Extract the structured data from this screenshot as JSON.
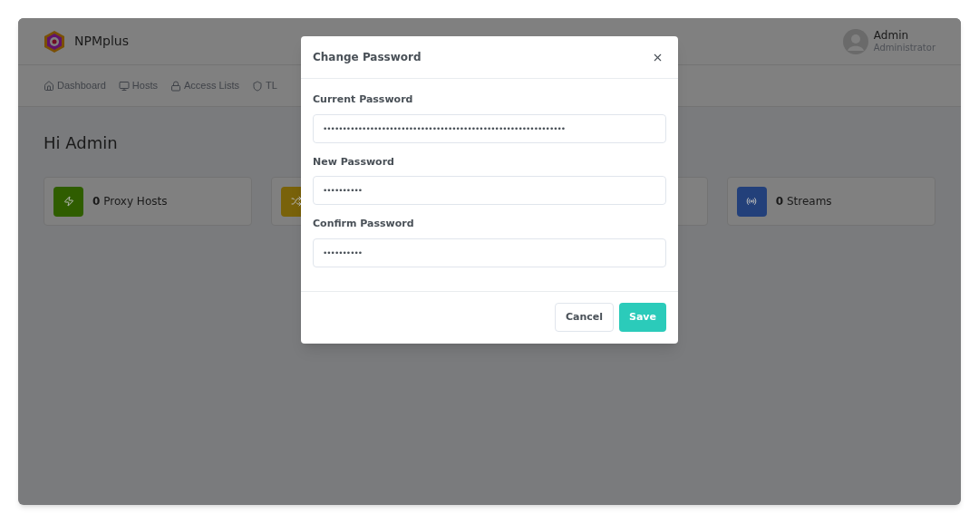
{
  "brand": {
    "name": "NPMplus"
  },
  "user": {
    "name": "Admin",
    "role": "Administrator"
  },
  "nav": [
    {
      "label": "Dashboard"
    },
    {
      "label": "Hosts"
    },
    {
      "label": "Access Lists"
    },
    {
      "label": "TL"
    }
  ],
  "greeting": "Hi Admin",
  "stats": [
    {
      "count": "0",
      "label": "Proxy Hosts",
      "color": "#2f5d00"
    },
    {
      "color": "#79620a"
    },
    {
      "count": "0",
      "label": "Streams",
      "color": "#23407a"
    }
  ],
  "modal": {
    "title": "Change Password",
    "fields": [
      {
        "label": "Current Password",
        "value": "••••••••••••••••••••••••••••••••••••••••••••••••••••••••••••••"
      },
      {
        "label": "New Password",
        "value": "••••••••••"
      },
      {
        "label": "Confirm Password",
        "value": "••••••••••"
      }
    ],
    "buttons": [
      {
        "label": "Cancel",
        "kind": "secondary"
      },
      {
        "label": "Save",
        "kind": "primary"
      }
    ]
  }
}
